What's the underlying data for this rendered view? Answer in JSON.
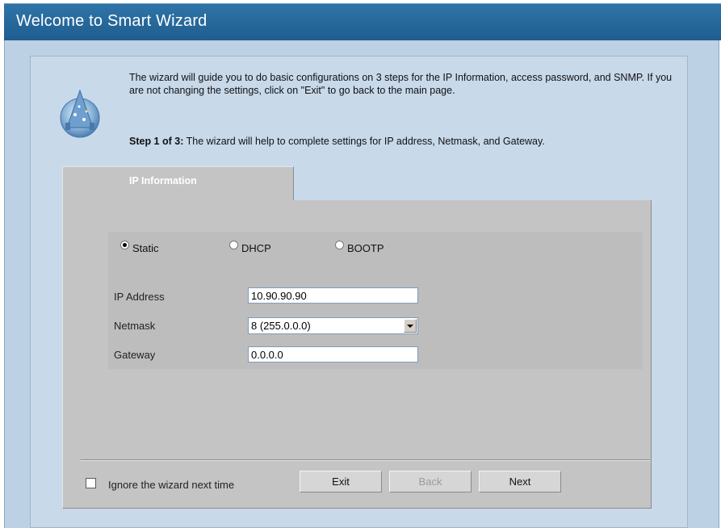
{
  "window": {
    "title": "Welcome to Smart Wizard"
  },
  "intro": {
    "text": "The wizard will guide you to do basic configurations on 3 steps for the IP Information, access password, and SNMP. If you are not changing the settings, click on \"Exit\" to go back to the main page.",
    "step_prefix": "Step 1 of 3:",
    "step_text": " The wizard will help to complete settings for IP address, Netmask, and Gateway.",
    "icon": "wizard-icon"
  },
  "tabs": [
    {
      "label": "IP Information",
      "active": true
    }
  ],
  "ip_mode": {
    "options": [
      {
        "label": "Static",
        "checked": true
      },
      {
        "label": "DHCP",
        "checked": false
      },
      {
        "label": "BOOTP",
        "checked": false
      }
    ]
  },
  "fields": {
    "ip_address": {
      "label": "IP Address",
      "value": "10.90.90.90"
    },
    "netmask": {
      "label": "Netmask",
      "value": "8 (255.0.0.0)"
    },
    "gateway": {
      "label": "Gateway",
      "value": "0.0.0.0"
    }
  },
  "footer": {
    "ignore_label": "Ignore the wizard next time",
    "ignore_checked": false,
    "buttons": {
      "exit": "Exit",
      "back": "Back",
      "next": "Next"
    }
  }
}
